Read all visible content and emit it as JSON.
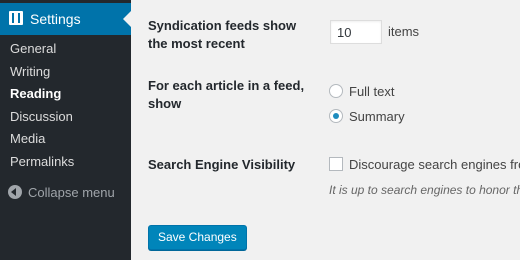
{
  "sidebar": {
    "header_label": "Settings",
    "header_icon": "settings-icon",
    "items": [
      {
        "label": "General",
        "active": false
      },
      {
        "label": "Writing",
        "active": false
      },
      {
        "label": "Reading",
        "active": true
      },
      {
        "label": "Discussion",
        "active": false
      },
      {
        "label": "Media",
        "active": false
      },
      {
        "label": "Permalinks",
        "active": false
      }
    ],
    "collapse_label": "Collapse menu"
  },
  "form": {
    "feeds_label": "Syndication feeds show the most recent",
    "feeds_value": "10",
    "feeds_unit": "items",
    "article_label": "For each article in a feed, show",
    "article_options": [
      {
        "label": "Full text",
        "selected": false
      },
      {
        "label": "Summary",
        "selected": true
      }
    ],
    "visibility_label": "Search Engine Visibility",
    "visibility_checkbox_label": "Discourage search engines from indexing this site",
    "visibility_checked": false,
    "visibility_description": "It is up to search engines to honor this request.",
    "save_label": "Save Changes"
  },
  "colors": {
    "sidebar_bg": "#23282d",
    "accent": "#0073aa",
    "button": "#0085ba",
    "page_bg": "#f1f1f1"
  }
}
